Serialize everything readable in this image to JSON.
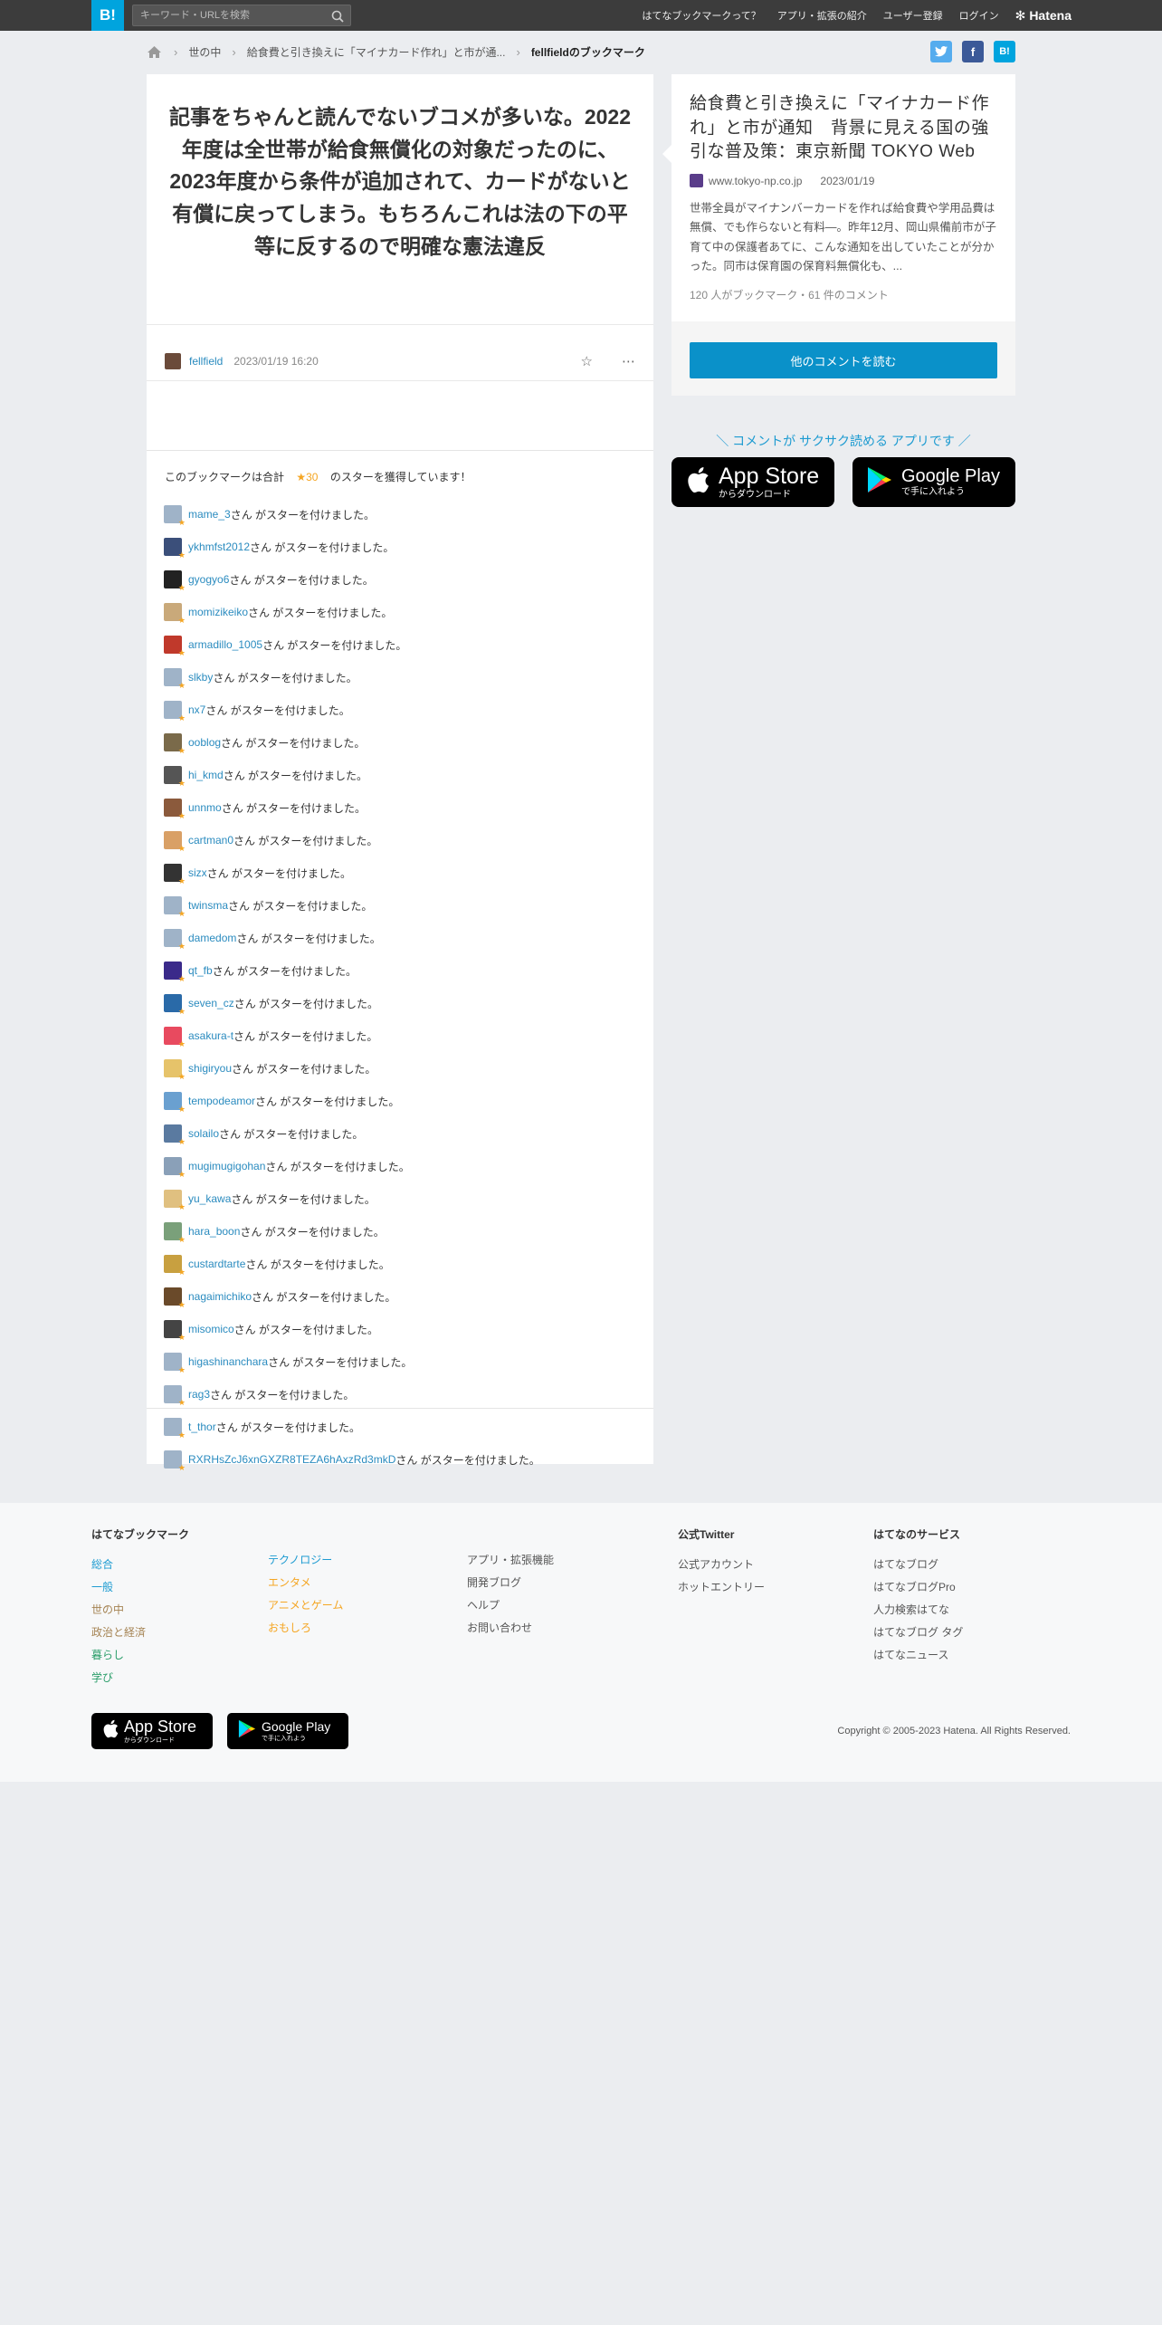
{
  "header": {
    "logo": "B!",
    "search_placeholder": "キーワード・URLを検索",
    "nav": [
      "はてなブックマークって？",
      "アプリ・拡張の紹介",
      "ユーザー登録",
      "ログイン"
    ],
    "brand": "Hatena"
  },
  "breadcrumb": {
    "items": [
      "世の中",
      "給食費と引き換えに「マイナカード作れ」と市が通...",
      "fellfieldのブックマーク"
    ]
  },
  "bookmark": {
    "comment": "記事をちゃんと読んでないブコメが多いな。2022年度は全世帯が給食無償化の対象だったのに、2023年度から条件が追加されて、カードがないと有償に戻ってしまう。もちろんこれは法の下の平等に反するので明確な憲法違反",
    "user": "fellfield",
    "datetime": "2023/01/19 16:20",
    "stars_prefix": "このブックマークは合計",
    "stars_count": "★30",
    "stars_suffix": "のスターを獲得しています！",
    "star_suffix_text": "さん がスターを付けました。",
    "star_users": [
      "mame_3",
      "ykhmfst2012",
      "gyogyo6",
      "momizikeiko",
      "armadillo_1005",
      "slkby",
      "nx7",
      "ooblog",
      "hi_kmd",
      "unnmo",
      "cartman0",
      "sizx",
      "twinsma",
      "damedom",
      "qt_fb",
      "seven_cz",
      "asakura-t",
      "shigiryou",
      "tempodeamor",
      "solailo",
      "mugimugigohan",
      "yu_kawa",
      "hara_boon",
      "custardtarte",
      "nagaimichiko",
      "misomico",
      "higashinanchara",
      "rag3",
      "t_thor",
      "RXRHsZcJ6xnGXZR8TEZA6hAxzRd3mkD"
    ]
  },
  "entry": {
    "title": "給食費と引き換えに「マイナカード作れ」と市が通知　背景に見える国の強引な普及策：東京新聞 TOKYO Web",
    "domain": "www.tokyo-np.co.jp",
    "date": "2023/01/19",
    "description": "世帯全員がマイナンバーカードを作れば給食費や学用品費は無償、でも作らないと有料―。昨年12月、岡山県備前市が子育て中の保護者あてに、こんな通知を出していたことが分かった。同市は保育園の保育料無償化も、...",
    "stats": "120 人がブックマーク・61 件のコメント",
    "button": "他のコメントを読む"
  },
  "promo": {
    "text": "＼ コメントが サクサク読める アプリです ／",
    "appstore_title": "App Store",
    "appstore_sub": "からダウンロード",
    "gplay_title": "Google Play",
    "gplay_sub": "で手に入れよう"
  },
  "footer": {
    "col1_title": "はてなブックマーク",
    "col1a": [
      "総合",
      "一般",
      "世の中",
      "政治と経済",
      "暮らし",
      "学び"
    ],
    "col1b": [
      "テクノロジー",
      "エンタメ",
      "アニメとゲーム",
      "おもしろ"
    ],
    "col2": [
      "アプリ・拡張機能",
      "開発ブログ",
      "ヘルプ",
      "お問い合わせ"
    ],
    "col3_title": "公式Twitter",
    "col3": [
      "公式アカウント",
      "ホットエントリー"
    ],
    "col4_title": "はてなのサービス",
    "col4": [
      "はてなブログ",
      "はてなブログPro",
      "人力検索はてな",
      "はてなブログ タグ",
      "はてなニュース"
    ],
    "copyright": "Copyright © 2005-2023 Hatena. All Rights Reserved."
  },
  "colors": {
    "accent": "#00a4de",
    "header_bg": "#3c3c3c",
    "link": "#2a8bbf",
    "star": "#f5a623"
  }
}
